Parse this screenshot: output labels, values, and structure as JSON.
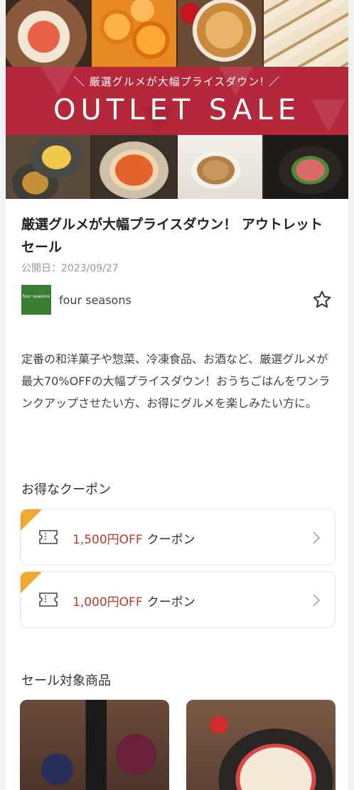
{
  "hero": {
    "subtitle": "＼ 厳選グルメが大幅プライスダウン! ／",
    "title": "OUTLET SALE"
  },
  "article": {
    "title": "厳選グルメが大幅プライスダウン！ アウトレットセール",
    "published": "公開日：2023/09/27",
    "publisher_name": "four seasons",
    "publisher_logo_text": "four seasons",
    "description": "定番の和洋菓子や惣菜、冷凍食品、お酒など、厳選グルメが最大70%OFFの大幅プライスダウン！おうちごはんをワンランクアップさせたい方、お得にグルメを楽しみたい方に。"
  },
  "coupons": {
    "section_title": "お得なクーポン",
    "items": [
      {
        "amount": "1,500円OFF",
        "suffix": "クーポン"
      },
      {
        "amount": "1,000円OFF",
        "suffix": "クーポン"
      }
    ]
  },
  "products": {
    "section_title": "セール対象商品"
  },
  "colors": {
    "accent_red": "#b5283c",
    "coupon_amount": "#c0392b",
    "coupon_corner": "#f0a830",
    "publisher_logo": "#3a7d34"
  },
  "icons": [
    "ticket-icon",
    "chevron-right-icon",
    "star-outline-icon"
  ]
}
